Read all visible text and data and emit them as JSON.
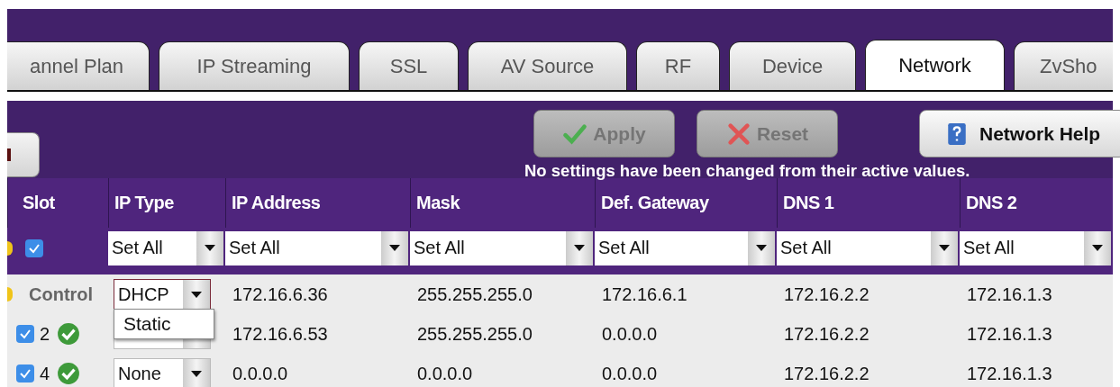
{
  "tabs": [
    {
      "label": "annel Plan",
      "selected": false
    },
    {
      "label": "IP Streaming",
      "selected": false
    },
    {
      "label": "SSL",
      "selected": false
    },
    {
      "label": "AV Source",
      "selected": false
    },
    {
      "label": "RF",
      "selected": false
    },
    {
      "label": "Device",
      "selected": false
    },
    {
      "label": "Network",
      "selected": true
    },
    {
      "label": "ZvSho",
      "selected": false
    }
  ],
  "toolbar": {
    "apply": {
      "label": "Apply",
      "disabled": true
    },
    "reset": {
      "label": "Reset",
      "disabled": true
    },
    "help": {
      "label": "Network Help"
    },
    "message": "No settings have been changed from their active values."
  },
  "table": {
    "columns": [
      "Slot",
      "IP Type",
      "IP Address",
      "Mask",
      "Def. Gateway",
      "DNS 1",
      "DNS 2"
    ],
    "set_all": {
      "checked": true,
      "fields": [
        "Set All",
        "Set All",
        "Set All",
        "Set All",
        "Set All",
        "Set All"
      ]
    },
    "rows": [
      {
        "kind": "control",
        "slot": "Control",
        "ip_type": "DHCP",
        "expanded": true,
        "options": [
          "Static"
        ],
        "ip_address": "172.16.6.36",
        "mask": "255.255.255.0",
        "def_gateway": "172.16.6.1",
        "dns_1": "172.16.2.2",
        "dns_2": "172.16.1.3"
      },
      {
        "kind": "slot",
        "slot": "2",
        "checked": true,
        "ok": true,
        "ip_address": "172.16.6.53",
        "mask": "255.255.255.0",
        "def_gateway": "0.0.0.0",
        "dns_1": "172.16.2.2",
        "dns_2": "172.16.1.3"
      },
      {
        "kind": "slot",
        "slot": "4",
        "checked": true,
        "ok": true,
        "ip_type": "None",
        "expanded": false,
        "ip_address": "0.0.0.0",
        "mask": "0.0.0.0",
        "def_gateway": "0.0.0.0",
        "dns_1": "172.16.2.2",
        "dns_2": "172.16.1.3"
      }
    ]
  }
}
